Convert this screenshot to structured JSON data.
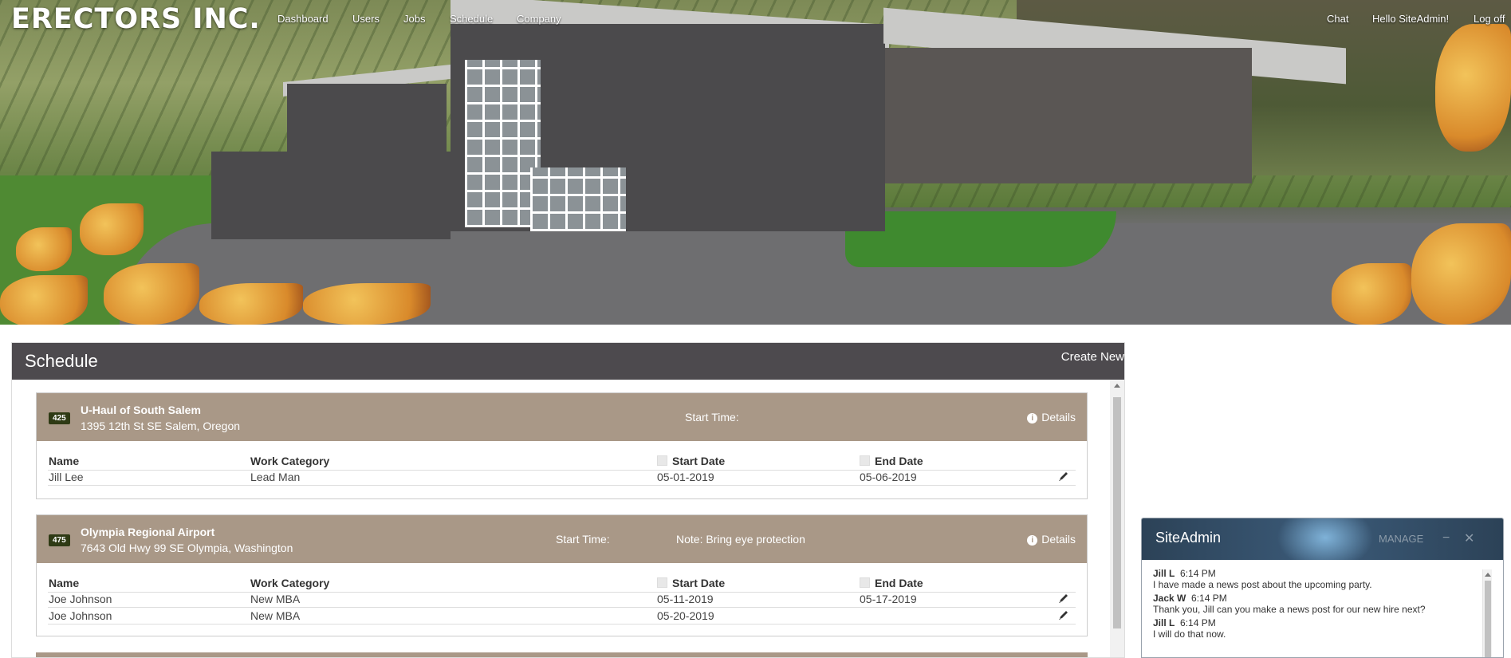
{
  "brand": "ERECTORS INC.",
  "nav": {
    "left": [
      "Dashboard",
      "Users",
      "Jobs",
      "Schedule",
      "Company"
    ],
    "chat": "Chat",
    "hello": "Hello SiteAdmin!",
    "logoff": "Log off"
  },
  "panel": {
    "title": "Schedule",
    "create_new": "Create New"
  },
  "columns": {
    "name": "Name",
    "category": "Work Category",
    "start": "Start Date",
    "end": "End Date"
  },
  "jobs": [
    {
      "id": "425",
      "name": "U-Haul of South Salem",
      "address": "1395 12th St SE Salem, Oregon",
      "start_time": "Start Time:",
      "note": "",
      "details": "Details",
      "rows": [
        {
          "name": "Jill Lee",
          "category": "Lead Man",
          "start": "05-01-2019",
          "end": "05-06-2019"
        }
      ]
    },
    {
      "id": "475",
      "name": "Olympia Regional Airport",
      "address": "7643 Old Hwy 99 SE Olympia, Washington",
      "start_time": "Start Time:",
      "note": "Note: Bring eye protection",
      "details": "Details",
      "rows": [
        {
          "name": "Joe Johnson",
          "category": "New MBA",
          "start": "05-11-2019",
          "end": "05-17-2019"
        },
        {
          "name": "Joe Johnson",
          "category": "New MBA",
          "start": "05-20-2019",
          "end": ""
        }
      ]
    }
  ],
  "chat": {
    "title": "SiteAdmin",
    "manage": "MANAGE",
    "minimize": "−",
    "close": "✕",
    "messages": [
      {
        "user": "Jill L",
        "time": "6:14 PM",
        "text": "I have made a news post about the upcoming party."
      },
      {
        "user": "Jack W",
        "time": "6:14 PM",
        "text": "Thank you, Jill can you make a news post for our new hire next?"
      },
      {
        "user": "Jill L",
        "time": "6:14 PM",
        "text": "I will do that now."
      }
    ]
  },
  "colors": {
    "panel_header": "#4d4a4e",
    "job_header": "#a99887",
    "badge": "#2e3a14",
    "chat_header": "#2c4257"
  },
  "icons": [
    "info-icon",
    "pencil-icon",
    "scroll-up-icon"
  ]
}
